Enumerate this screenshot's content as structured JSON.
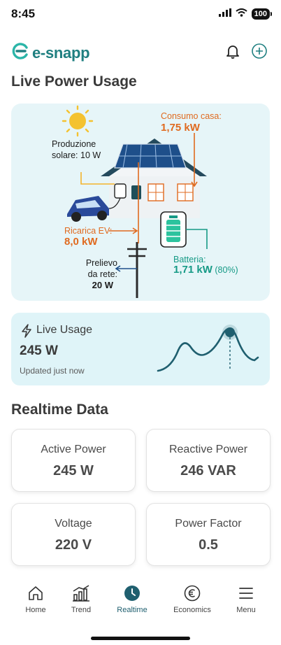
{
  "status_bar": {
    "time": "8:45",
    "battery": "100"
  },
  "header": {
    "logo_text": "e-snapp",
    "icons": [
      "bell-icon",
      "add-circle-icon"
    ]
  },
  "live_power": {
    "title": "Live Power Usage",
    "solar_label": "Produzione solare: 10 W",
    "house_label": "Consumo casa:",
    "house_value": "1,75 kW",
    "ev_label": "Ricarica EV:",
    "ev_value": "8,0 kW",
    "battery_label": "Batteria:",
    "battery_value": "1,71 kW",
    "battery_percent": "(80%)",
    "grid_label": "Prelievo da rete:",
    "grid_value": "20 W"
  },
  "live_usage": {
    "title": "Live Usage",
    "value": "245 W",
    "updated": "Updated just now",
    "icon": "lightning-icon"
  },
  "realtime": {
    "title": "Realtime Data",
    "metrics": [
      {
        "label": "Active Power",
        "value": "245 W"
      },
      {
        "label": "Reactive Power",
        "value": "246 VAR"
      },
      {
        "label": "Voltage",
        "value": "220 V"
      },
      {
        "label": "Power Factor",
        "value": "0.5"
      }
    ]
  },
  "tabs": [
    {
      "label": "Home",
      "icon": "home-icon"
    },
    {
      "label": "Trend",
      "icon": "bar-chart-icon"
    },
    {
      "label": "Realtime",
      "icon": "clock-icon",
      "active": true
    },
    {
      "label": "Economics",
      "icon": "euro-icon"
    },
    {
      "label": "Menu",
      "icon": "menu-icon"
    }
  ],
  "colors": {
    "brand": "#1f7f80",
    "accent_orange": "#e06a1f",
    "accent_teal": "#169a86",
    "active_tab": "#1f5f6f"
  }
}
